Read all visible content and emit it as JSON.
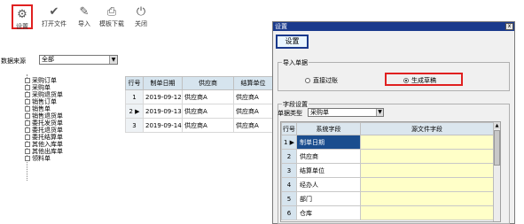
{
  "toolbar": {
    "buttons": [
      {
        "label": "设置",
        "icon": "gear-icon"
      },
      {
        "label": "打开文件",
        "icon": "check-icon"
      },
      {
        "label": "导入",
        "icon": "edit-icon"
      },
      {
        "label": "模板下载",
        "icon": "printer-icon"
      },
      {
        "label": "关闭",
        "icon": "power-icon"
      }
    ]
  },
  "source": {
    "label": "数据来源",
    "value": "全部"
  },
  "tree": {
    "items": [
      "采购订单",
      "采购单",
      "采购退货单",
      "销售订单",
      "销售单",
      "销售退货单",
      "委托发货单",
      "委托退货单",
      "委托结算单",
      "其他入库单",
      "其他出库单",
      "领料单"
    ]
  },
  "grid": {
    "headers": [
      "行号",
      "制单日期",
      "供应商",
      "结算单位"
    ],
    "rows": [
      {
        "num": "1",
        "marker": "",
        "date": "2019-09-12",
        "supplier": "供应商A",
        "settle": "供应商A"
      },
      {
        "num": "2",
        "marker": "▶",
        "date": "2019-09-13",
        "supplier": "供应商A",
        "settle": "供应商A"
      },
      {
        "num": "3",
        "marker": "",
        "date": "2019-09-14",
        "supplier": "供应商A",
        "settle": "供应商A"
      }
    ]
  },
  "dialog": {
    "title": "设置",
    "close": "x",
    "main_button": "设置",
    "import_group": "导入单据",
    "radio_direct": "直接过账",
    "radio_generate": "生成草稿",
    "field_group": "字段设置",
    "type_label": "单据类型",
    "type_value": "采购单",
    "field_headers": [
      "行号",
      "系统字段",
      "源文件字段"
    ],
    "field_rows": [
      {
        "num": "1",
        "marker": "▶",
        "field": "制单日期"
      },
      {
        "num": "2",
        "marker": "",
        "field": "供应商"
      },
      {
        "num": "3",
        "marker": "",
        "field": "结算单位"
      },
      {
        "num": "4",
        "marker": "",
        "field": "经办人"
      },
      {
        "num": "5",
        "marker": "",
        "field": "部门"
      },
      {
        "num": "6",
        "marker": "",
        "field": "仓库"
      }
    ]
  },
  "colors": {
    "accent": "#1a3a8c",
    "highlight_box": "#e02020",
    "selected_cell": "#1a4d8e",
    "source_cell": "#ffffc8"
  }
}
